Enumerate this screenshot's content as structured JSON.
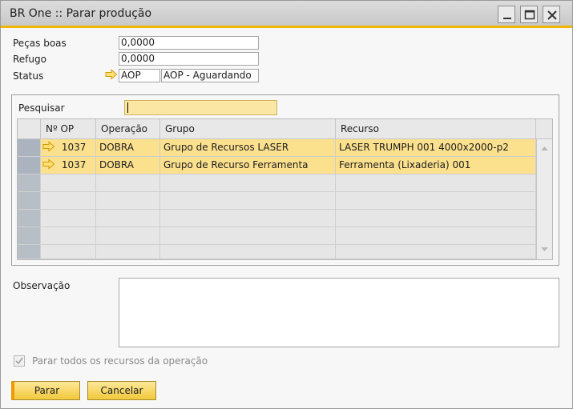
{
  "window": {
    "title": "BR One :: Parar produção",
    "accent_color": "#f1b700"
  },
  "form": {
    "pecas_boas": {
      "label": "Peças boas",
      "value": "0,0000"
    },
    "refugo": {
      "label": "Refugo",
      "value": "0,0000"
    },
    "status": {
      "label": "Status",
      "code": "AOP",
      "description": "AOP - Aguardando"
    }
  },
  "search": {
    "label": "Pesquisar",
    "value": ""
  },
  "grid": {
    "columns": [
      "Nº OP",
      "Operação",
      "Grupo",
      "Recurso"
    ],
    "rows": [
      {
        "op": "1037",
        "operacao": "DOBRA",
        "grupo": "Grupo de Recursos LASER",
        "recurso": "LASER TRUMPH 001 4000x2000-p2"
      },
      {
        "op": "1037",
        "operacao": "DOBRA",
        "grupo": "Grupo de Recurso Ferramenta",
        "recurso": "Ferramenta (Lixaderia) 001"
      }
    ],
    "row_highlight_color": "#fbe08e"
  },
  "observacao": {
    "label": "Observação",
    "value": ""
  },
  "checkbox": {
    "label": "Parar todos os recursos da operação",
    "checked": true,
    "disabled": true
  },
  "buttons": {
    "ok": "Parar",
    "cancel": "Cancelar"
  },
  "icons": {
    "link_arrow": "link-arrow-icon",
    "minimize": "minimize-icon",
    "maximize": "maximize-icon",
    "close": "close-icon"
  }
}
